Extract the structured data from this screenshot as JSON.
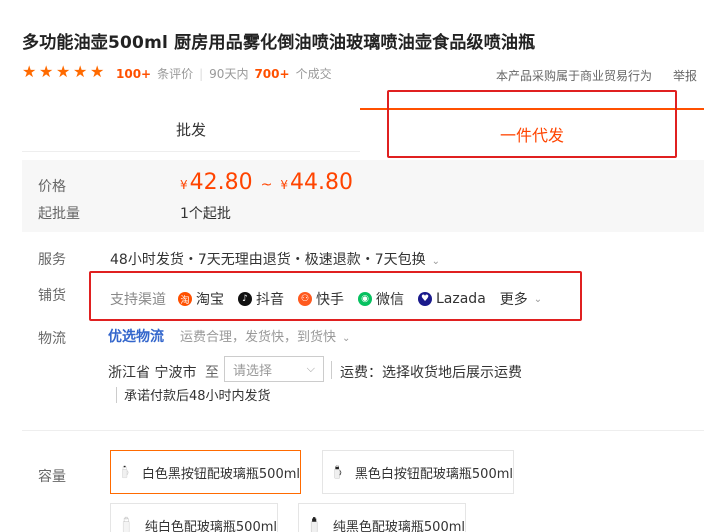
{
  "product": {
    "title": "多功能油壶500ml 厨房用品雾化倒油喷油玻璃喷油壶食品级喷油瓶",
    "stars": 5,
    "review_count": "100+",
    "review_label": "条评价",
    "period_label": "90天内",
    "sales_count": "700+",
    "sales_label": "个成交",
    "trade_note": "本产品采购属于商业贸易行为",
    "report_label": "举报"
  },
  "tabs": {
    "wholesale": "批发",
    "dropship": "一件代发"
  },
  "pricing": {
    "price_label": "价格",
    "currency": "¥",
    "price_min": "42.80",
    "tilde": "~",
    "price_max": "44.80",
    "moq_label": "起批量",
    "moq_value": "1个起批"
  },
  "service": {
    "label": "服务",
    "value": "48小时发货・7天无理由退货・极速退款・7天包换"
  },
  "distribution": {
    "label": "铺货",
    "channels_head": "支持渠道",
    "channels": [
      {
        "name": "淘宝",
        "icon": "taobao-icon",
        "color": "#ff5000",
        "glyph": "淘"
      },
      {
        "name": "抖音",
        "icon": "douyin-icon",
        "color": "#111111",
        "glyph": "♪"
      },
      {
        "name": "快手",
        "icon": "kuaishou-icon",
        "color": "#ff5a1f",
        "glyph": "⚇"
      },
      {
        "name": "微信",
        "icon": "wechat-icon",
        "color": "#07c160",
        "glyph": "◉"
      },
      {
        "name": "Lazada",
        "icon": "lazada-icon",
        "color": "#1a1a8c",
        "glyph": "♥"
      }
    ],
    "more_label": "更多"
  },
  "logistics": {
    "label": "物流",
    "brand": "优选物流",
    "desc": "运费合理，发货快，到货快",
    "origin": "浙江省 宁波市",
    "to_label": "至",
    "select_placeholder": "请选择",
    "freight": "运费：选择收货地后展示运费",
    "promise": "承诺付款后48小时内发货"
  },
  "capacity": {
    "label": "容量",
    "options": [
      {
        "name": "白色黑按钮配玻璃瓶500ml",
        "selected": true
      },
      {
        "name": "黑色白按钮配玻璃瓶500ml",
        "selected": false
      },
      {
        "name": "纯白色配玻璃瓶500ml",
        "selected": false
      },
      {
        "name": "纯黑色配玻璃瓶500ml",
        "selected": false
      }
    ]
  },
  "colors": {
    "accent": "#ff5000",
    "highlight_box": "#e02020",
    "logistics_blue": "#3366cc"
  }
}
